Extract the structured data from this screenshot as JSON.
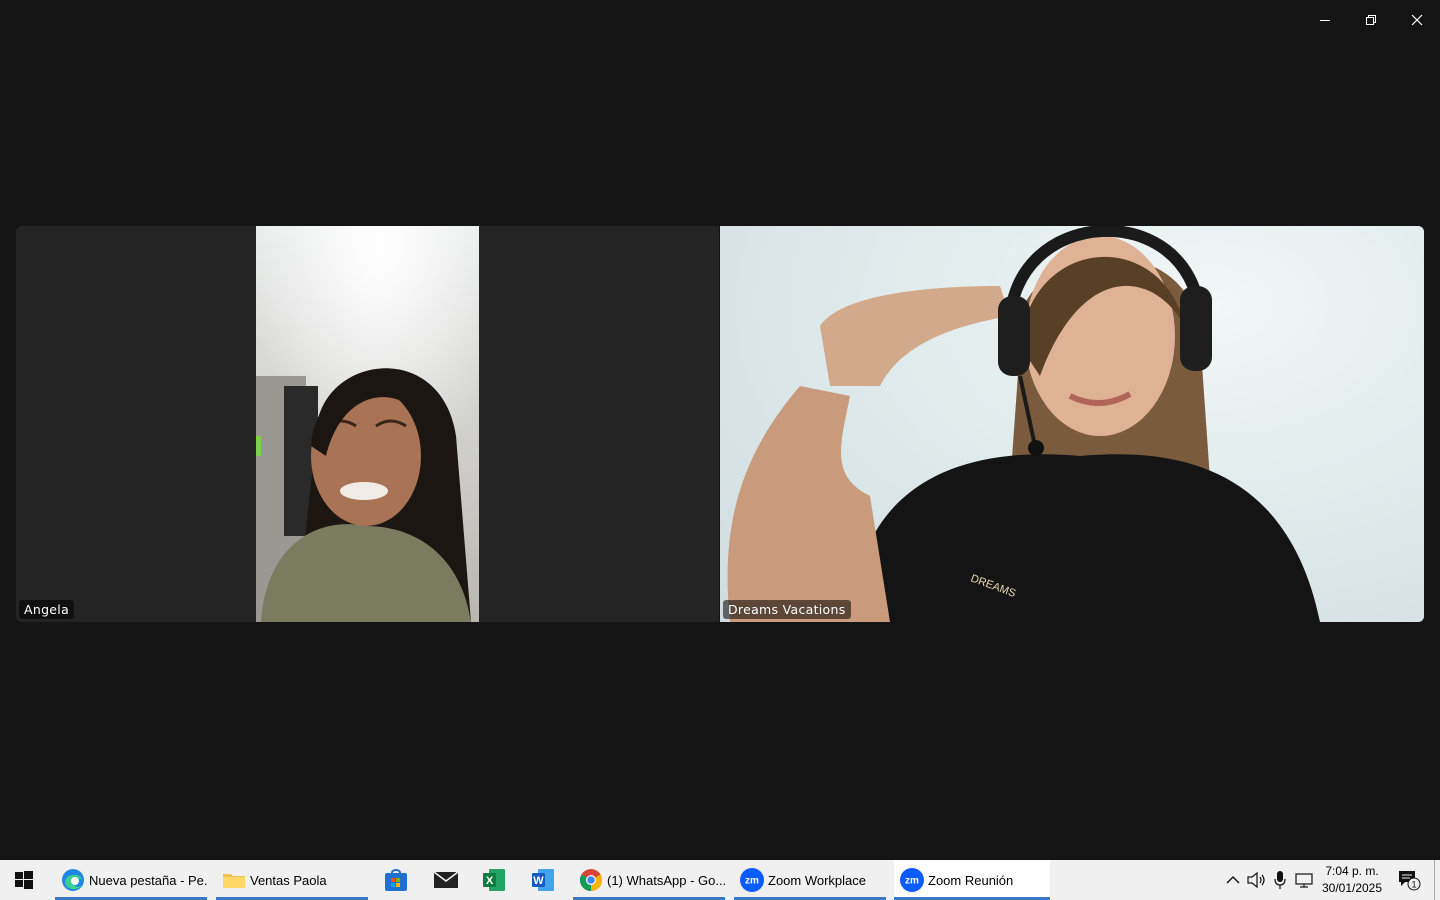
{
  "window": {
    "controls": {
      "minimize": "minimize-icon",
      "maximize": "restore-icon",
      "close": "close-icon"
    }
  },
  "participants": [
    {
      "name": "Angela"
    },
    {
      "name": "Dreams Vacations"
    }
  ],
  "taskbar": {
    "apps": [
      {
        "label": "Nueva pestaña - Pe...",
        "icon": "edge-icon"
      },
      {
        "label": "Ventas Paola",
        "icon": "folder-icon"
      },
      {
        "label": "(1) WhatsApp - Go...",
        "icon": "chrome-icon"
      },
      {
        "label": "Zoom Workplace",
        "icon": "zoom-icon"
      },
      {
        "label": "Zoom Reunión",
        "icon": "zoom-icon"
      }
    ],
    "pinned": [
      "store-icon",
      "mail-icon",
      "excel-icon",
      "word-icon"
    ],
    "zoom_badge": "zm",
    "clock": {
      "time": "7:04 p. m.",
      "date": "30/01/2025"
    },
    "notifications_count": "1",
    "accent_color": "#3c78c8"
  }
}
